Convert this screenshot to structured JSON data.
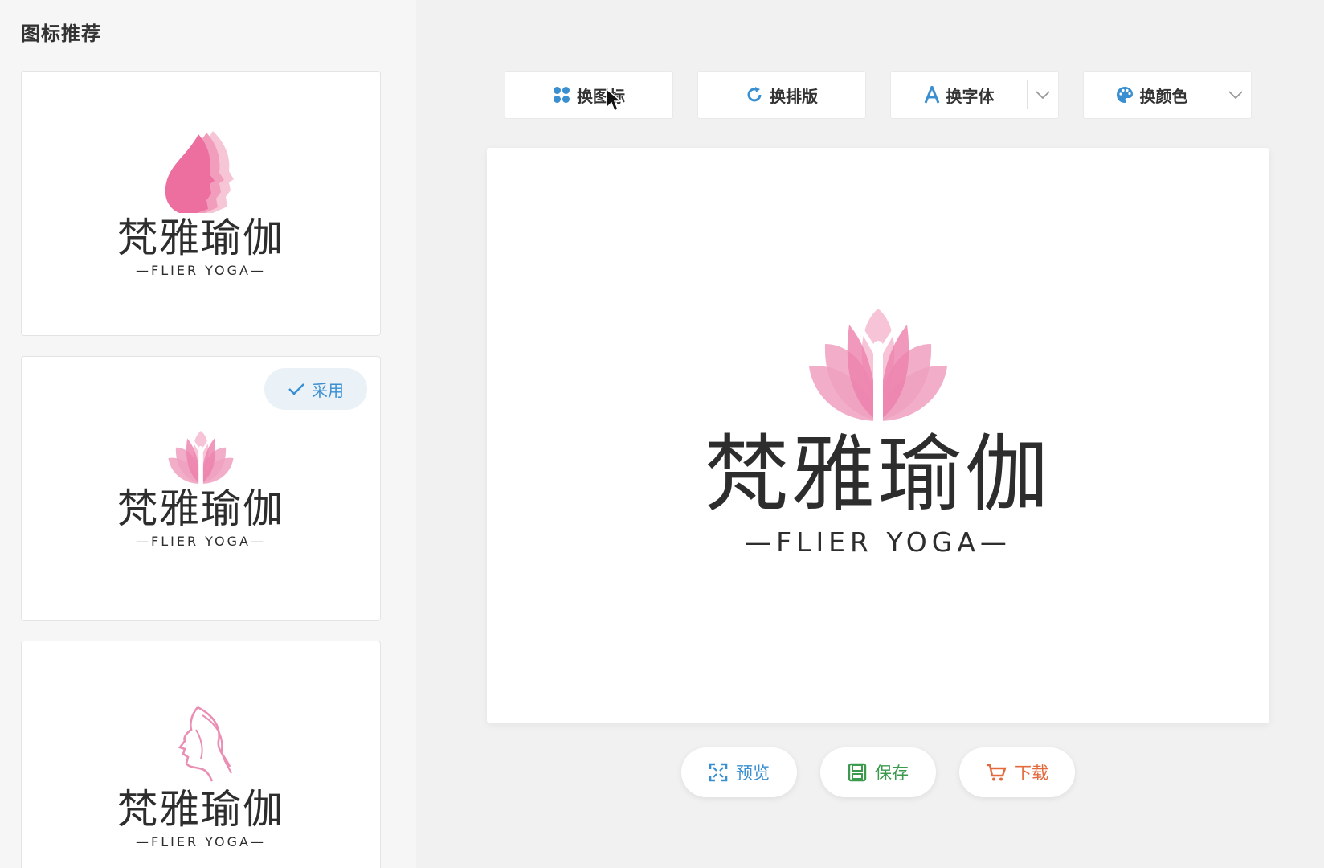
{
  "sidebar": {
    "title": "图标推荐",
    "cards": [
      {
        "cn": "梵雅瑜伽",
        "en": "—FLIER YOGA—",
        "icon": "face-silhouette-icon"
      },
      {
        "cn": "梵雅瑜伽",
        "en": "—FLIER YOGA—",
        "icon": "lotus-figure-icon",
        "badge": "采用"
      },
      {
        "cn": "梵雅瑜伽",
        "en": "—FLIER YOGA—",
        "icon": "face-line-art-icon"
      }
    ]
  },
  "toolbar": {
    "change_icon": "换图标",
    "change_layout": "换排版",
    "change_font": "换字体",
    "change_color": "换颜色"
  },
  "canvas": {
    "cn": "梵雅瑜伽",
    "en": "—FLIER YOGA—"
  },
  "actions": {
    "preview": "预览",
    "save": "保存",
    "download": "下载"
  },
  "colors": {
    "accent_blue": "#3a8fd0",
    "save_green": "#3c9a4e",
    "download_orange": "#e36a3c",
    "lotus_pink": "#ee8fb5"
  }
}
